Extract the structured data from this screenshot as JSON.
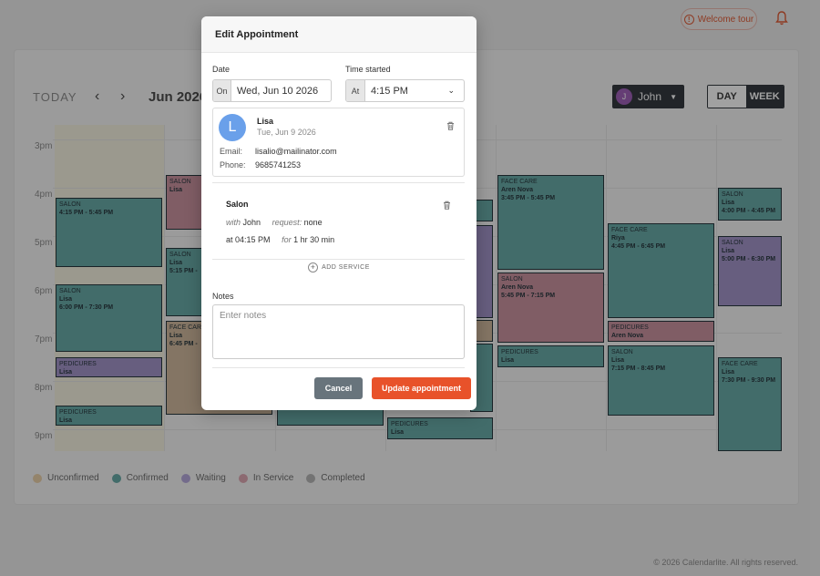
{
  "header": {
    "welcome_tour_label": "Welcome tour",
    "icons": [
      "info-icon",
      "bell-icon"
    ]
  },
  "toolbar": {
    "today_label": "TODAY",
    "prev_glyph": "‹",
    "next_glyph": "›",
    "month_label": "Jun 2026",
    "staff_name": "John",
    "staff_initial": "J",
    "view_day": "DAY",
    "view_week": "WEEK"
  },
  "hours": [
    "3pm",
    "4pm",
    "5pm",
    "6pm",
    "7pm",
    "8pm",
    "9pm"
  ],
  "appointments": [
    {
      "service": "SALON",
      "name": "",
      "time": "4:15 PM - 5:45 PM",
      "color": "teal"
    },
    {
      "service": "SALON",
      "name": "Lisa",
      "time": "6:00 PM - 7:30 PM",
      "color": "teal"
    },
    {
      "service": "PEDICURES",
      "name": "Lisa",
      "time": "",
      "color": "purple"
    },
    {
      "service": "PEDICURES",
      "name": "Lisa",
      "time": "",
      "color": "teal"
    },
    {
      "service": "SALON",
      "name": "Lisa",
      "time": "",
      "color": "pink"
    },
    {
      "service": "SALON",
      "name": "Lisa",
      "time": "5:15 PM -",
      "color": "teal"
    },
    {
      "service": "FACE CARE",
      "name": "Lisa",
      "time": "6:45 PM -",
      "color": "peach"
    },
    {
      "service": "PEDICURES",
      "name": "Lisa",
      "time": "",
      "color": "teal"
    },
    {
      "service": "FACE CARE",
      "name": "Aren Nova",
      "time": "3:45 PM - 5:45 PM",
      "color": "teal"
    },
    {
      "service": "SALON",
      "name": "Aren Nova",
      "time": "5:45 PM - 7:15 PM",
      "color": "pink"
    },
    {
      "service": "PEDICURES",
      "name": "Lisa",
      "time": "",
      "color": "teal"
    },
    {
      "service": "FACE CARE",
      "name": "Riya",
      "time": "4:45 PM - 6:45 PM",
      "color": "teal"
    },
    {
      "service": "PEDICURES",
      "name": "Aren Nova",
      "time": "",
      "color": "pink"
    },
    {
      "service": "SALON",
      "name": "Lisa",
      "time": "7:15 PM - 8:45 PM",
      "color": "teal"
    },
    {
      "service": "SALON",
      "name": "Lisa",
      "time": "4:00 PM - 4:45 PM",
      "color": "teal"
    },
    {
      "service": "SALON",
      "name": "Lisa",
      "time": "5:00 PM - 6:30 PM",
      "color": "purple"
    },
    {
      "service": "FACE CARE",
      "name": "Lisa",
      "time": "7:30 PM - 9:30 PM",
      "color": "teal"
    }
  ],
  "legend": [
    {
      "label": "Unconfirmed",
      "color": "#e9cfa6"
    },
    {
      "label": "Confirmed",
      "color": "#62a7a3"
    },
    {
      "label": "Waiting",
      "color": "#b3a6db"
    },
    {
      "label": "In Service",
      "color": "#dca4b0"
    },
    {
      "label": "Completed",
      "color": "#b3b3b3"
    }
  ],
  "footer": "© 2026 Calendarlite. All rights reserved.",
  "modal": {
    "title": "Edit Appointment",
    "date_label": "Date",
    "date_prefix": "On",
    "date_value": "Wed, Jun 10 2026",
    "time_label": "Time started",
    "time_prefix": "At",
    "time_value": "4:15 PM",
    "client": {
      "initial": "L",
      "name": "Lisa",
      "date": "Tue, Jun 9 2026",
      "email_label": "Email:",
      "email": "lisalio@mailinator.com",
      "phone_label": "Phone:",
      "phone": "9685741253"
    },
    "service": {
      "name": "Salon",
      "with_label": "with",
      "staff": "John",
      "request_label": "request:",
      "request": "none",
      "at_label": "at",
      "at_time": "04:15 PM",
      "for_label": "for",
      "duration": "1 hr 30 min"
    },
    "add_service": "ADD SERVICE",
    "notes_label": "Notes",
    "notes_placeholder": "Enter notes",
    "cancel": "Cancel",
    "update": "Update appointment"
  }
}
